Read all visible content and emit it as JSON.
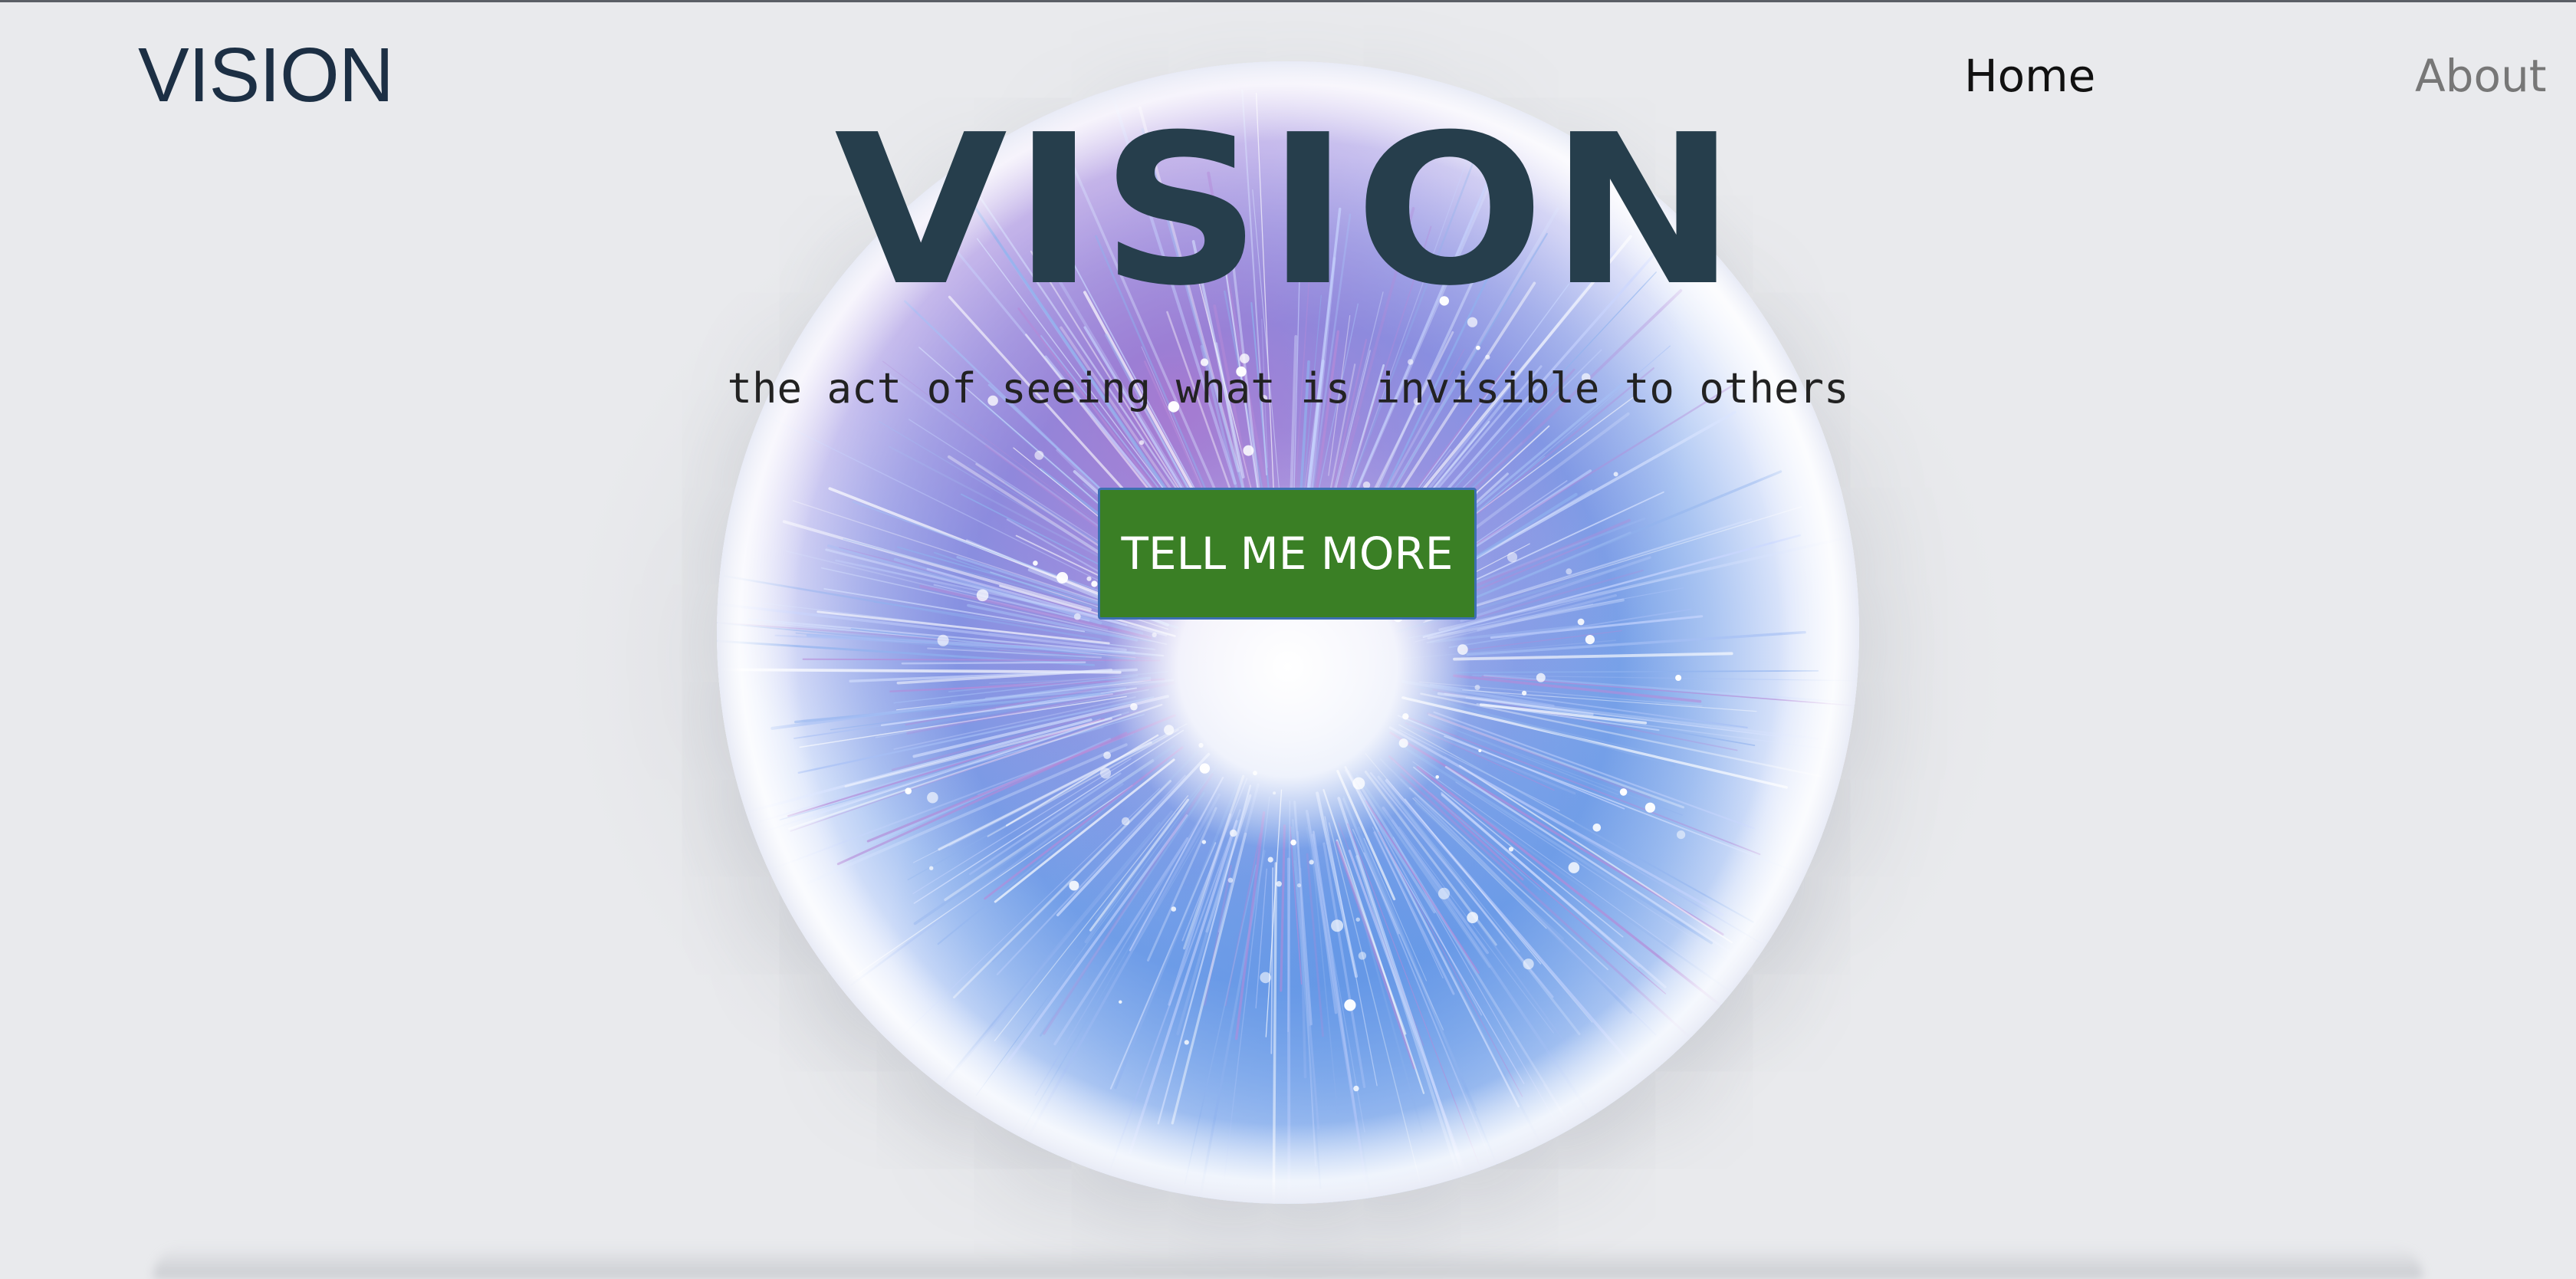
{
  "nav": {
    "brand": "VISION",
    "links": [
      {
        "label": "Home",
        "active": true
      },
      {
        "label": "About",
        "active": false
      }
    ]
  },
  "hero": {
    "title": "VISION",
    "subtitle": "the act of seeing what is invisible to others",
    "cta_label": "TELL ME MORE",
    "image": "iris-eye-orb"
  },
  "colors": {
    "background": "#e9eaed",
    "brand_text": "#1c2f44",
    "title_text": "#263e4c",
    "cta_background": "#3a7f25",
    "cta_border": "#3d6fb3",
    "nav_active": "#111111",
    "nav_inactive": "#777777"
  }
}
